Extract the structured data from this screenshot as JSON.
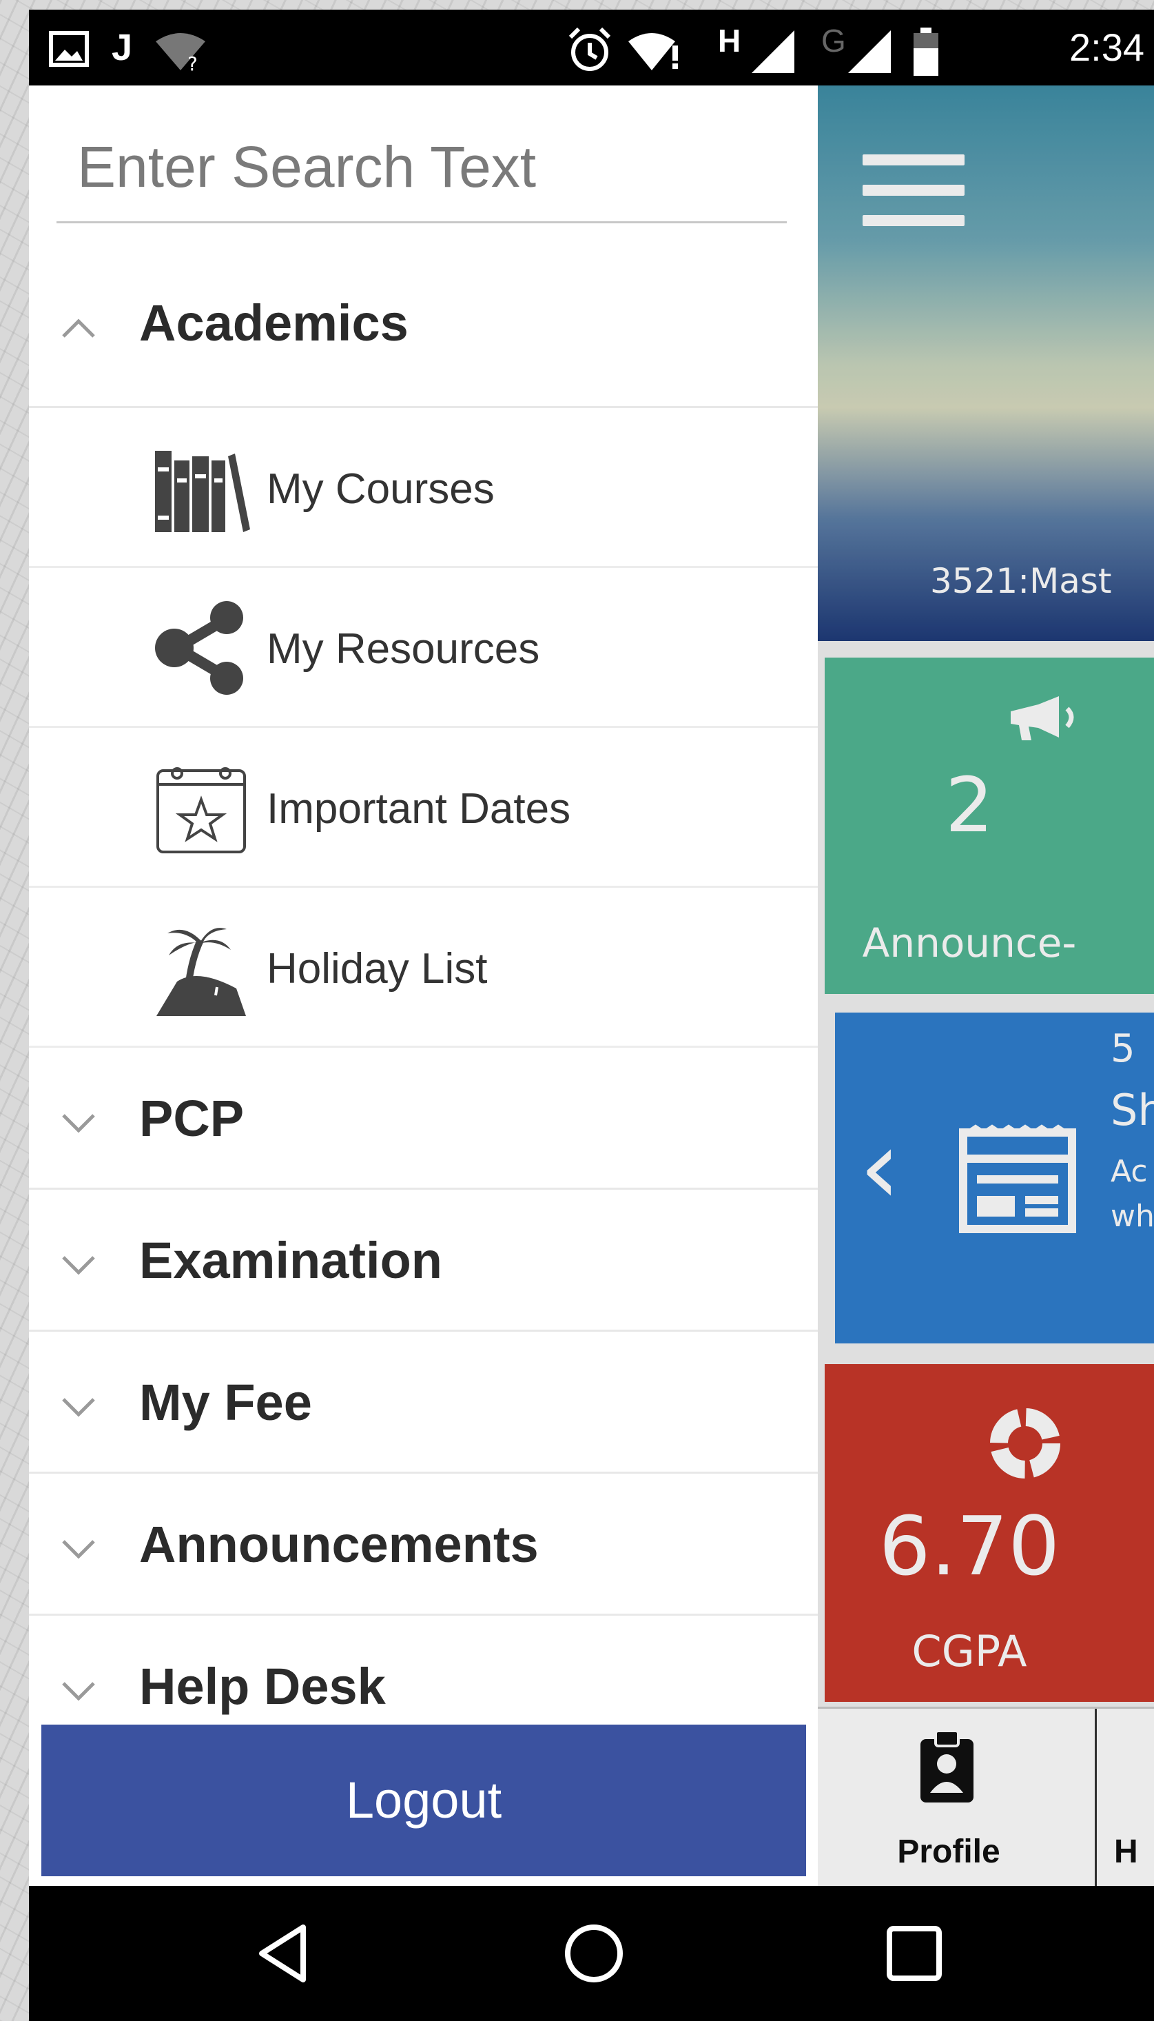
{
  "status_bar": {
    "time": "2:34",
    "signal_h": "H",
    "signal_g": "G",
    "wifi_mark": "?",
    "icons": [
      "image-icon",
      "j-notification-icon",
      "wifi-unknown-icon",
      "alarm-icon",
      "wifi-alert-icon",
      "signal-h-icon",
      "signal-g-icon",
      "battery-icon"
    ]
  },
  "drawer": {
    "search_placeholder": "Enter Search Text",
    "sections": [
      {
        "title": "Academics",
        "expanded": true,
        "items": [
          {
            "label": "My Courses",
            "icon": "books-icon"
          },
          {
            "label": "My Resources",
            "icon": "share-icon"
          },
          {
            "label": "Important Dates",
            "icon": "calendar-star-icon"
          },
          {
            "label": "Holiday List",
            "icon": "palm-island-icon"
          }
        ]
      },
      {
        "title": "PCP",
        "expanded": false
      },
      {
        "title": "Examination",
        "expanded": false
      },
      {
        "title": "My Fee",
        "expanded": false
      },
      {
        "title": "Announcements",
        "expanded": false
      },
      {
        "title": "Help Desk",
        "expanded": false
      }
    ],
    "logout_label": "Logout"
  },
  "app": {
    "hero_text": "3521:Mast",
    "tiles": {
      "announcements": {
        "value": "2",
        "label": "Announce-",
        "color": "#52b794",
        "icon": "megaphone-icon"
      },
      "schedule": {
        "line1": "5",
        "line2": "Sh",
        "line3": "Ac",
        "line4": "wh",
        "color": "#2f7ecf",
        "icon": "calendar-icon",
        "nav_icon": "chevron-left-icon"
      },
      "cgpa": {
        "value": "6.70",
        "label": "CGPA",
        "color": "#c8382a",
        "icon": "donut-chart-icon"
      }
    },
    "bottom_nav": {
      "profile_label": "Profile",
      "other_label": "H"
    }
  },
  "nav_bar": {
    "buttons": [
      "back-icon",
      "home-icon",
      "recents-icon"
    ]
  }
}
